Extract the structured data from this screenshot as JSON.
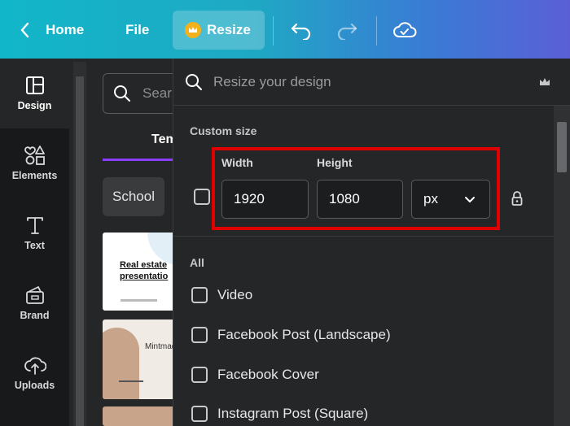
{
  "topbar": {
    "home_label": "Home",
    "file_label": "File",
    "resize_label": "Resize"
  },
  "sidebar": {
    "items": [
      {
        "label": "Design",
        "icon": "layout-icon"
      },
      {
        "label": "Elements",
        "icon": "shapes-icon"
      },
      {
        "label": "Text",
        "icon": "text-icon"
      },
      {
        "label": "Brand",
        "icon": "brand-icon"
      },
      {
        "label": "Uploads",
        "icon": "upload-cloud-icon"
      }
    ]
  },
  "panel": {
    "search_placeholder": "Sear",
    "tab_label": "Tem",
    "chip_label": "School",
    "card1_title": "Real estate presentatio",
    "card2_title": "Mintmad"
  },
  "resize_menu": {
    "search_placeholder": "Resize your design",
    "custom_size_title": "Custom size",
    "width_label": "Width",
    "height_label": "Height",
    "width_value": "1920",
    "height_value": "1080",
    "unit_value": "px",
    "all_title": "All",
    "options": [
      "Video",
      "Facebook Post (Landscape)",
      "Facebook Cover",
      "Instagram Post (Square)"
    ]
  },
  "colors": {
    "topbar_start": "#12b6c9",
    "topbar_end": "#5b5fd6",
    "highlight": "#e00000",
    "background": "#18191b"
  }
}
